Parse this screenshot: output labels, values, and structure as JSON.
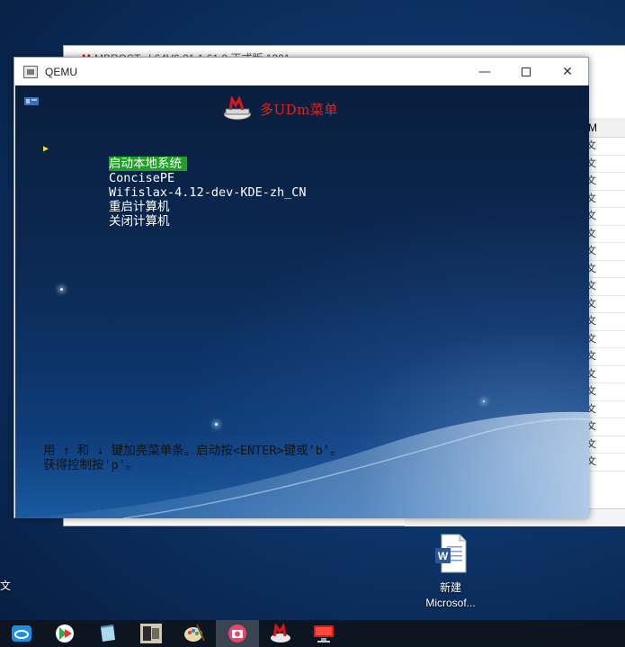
{
  "background_window": {
    "title": "MBROST...I 64V6 21 1.61.2 正式版 1201",
    "column_header": "M",
    "cells": [
      "文",
      "文",
      "文",
      "文",
      "文",
      "文",
      "文",
      "文",
      "文",
      "文",
      "文",
      "文",
      "文",
      "文",
      "文",
      "文",
      "文",
      "文",
      "文"
    ]
  },
  "qemu": {
    "title": "QEMU",
    "buttons": {
      "minimize": "—",
      "close": "✕"
    },
    "menu_title": "多UDm菜单",
    "menu_items": [
      {
        "label": "启动本地系统",
        "selected": true
      },
      {
        "label": "ConcisePE",
        "selected": false
      },
      {
        "label": "Wifislax-4.12-dev-KDE-zh_CN",
        "selected": false
      },
      {
        "label": "重启计算机",
        "selected": false
      },
      {
        "label": "关闭计算机",
        "selected": false
      }
    ],
    "pointer_glyph": "▶",
    "hint_line1": "用 ↑ 和 ↓ 键加亮菜单条。启动按<ENTER>键或'b'。",
    "hint_line2": "获得控制按'p'。"
  },
  "desktop": {
    "icon_label_line1": "新建",
    "icon_label_line2": "Microsof...",
    "left_edge_text": "文"
  },
  "taskbar": {
    "items": [
      "cloud-app-icon",
      "media-player-icon",
      "notepad-icon",
      "photo-viewer-icon",
      "paint-icon",
      "camera-app-icon",
      "mbrost-tool-icon",
      "remote-desktop-icon"
    ],
    "active_index": 5
  },
  "colors": {
    "menu_title": "#e8201a",
    "selected_bg": "#1da324",
    "pointer": "#f0e020",
    "word_blue": "#2b579a"
  }
}
